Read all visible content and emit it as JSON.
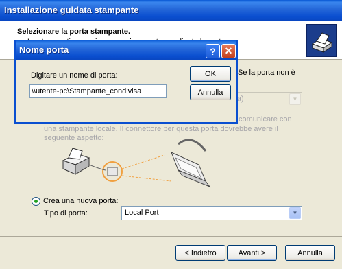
{
  "wizard": {
    "title": "Installazione guidata stampante",
    "header_title": "Selezionare la porta stampante.",
    "header_subtitle": "Le stampanti comunicano con i computer mediante le porte.",
    "right_text": "Se la porta non è",
    "disabled_combo_value": "niata)",
    "desc_line1": "comunicare con",
    "desc_line2": "una stampante locale. Il connettore per questa porta dovrebbe avere il",
    "desc_line3": "seguente aspetto:",
    "create_port_label": "Crea una nuova porta:",
    "port_type_label": "Tipo di porta:",
    "port_type_value": "Local Port",
    "back_button": "< Indietro",
    "next_button": "Avanti >",
    "cancel_button": "Annulla"
  },
  "dialog": {
    "title": "Nome porta",
    "help_glyph": "?",
    "close_glyph": "✕",
    "prompt": "Digitare un nome di porta:",
    "port_name_value": "\\\\utente-pc\\Stampante_condivisa",
    "ok_button": "OK",
    "cancel_button": "Annulla"
  },
  "icons": {
    "combo_arrow": "chevron-down-icon",
    "header": "printer-wizard-icon"
  },
  "colors": {
    "titlebar": "#0a4fd0",
    "window_bg": "#ece9d8",
    "radio_dot": "#21a121",
    "port_highlight": "#f0a040"
  }
}
